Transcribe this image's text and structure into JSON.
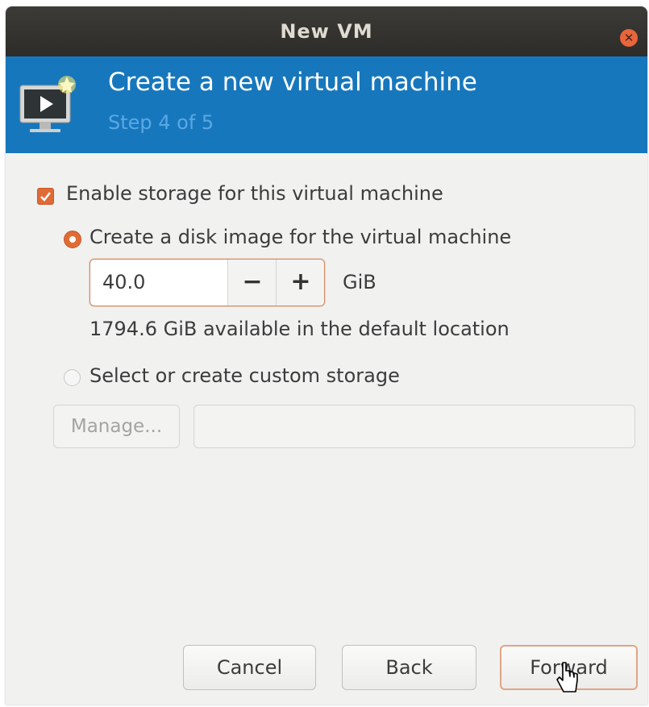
{
  "window": {
    "title": "New VM",
    "close_icon": "close-icon"
  },
  "header": {
    "title": "Create a new virtual machine",
    "step": "Step 4 of 5",
    "icon": "vm-monitor-icon",
    "accent_color": "#1777bd"
  },
  "storage": {
    "enable_label": "Enable storage for this virtual machine",
    "enable_checked": true,
    "create_disk_label": "Create a disk image for the virtual machine",
    "create_disk_selected": true,
    "size_value": "40.0",
    "size_unit": "GiB",
    "decrement_label": "−",
    "increment_label": "+",
    "available_text": "1794.6 GiB available in the default location",
    "custom_storage_label": "Select or create custom storage",
    "custom_storage_selected": false,
    "manage_label": "Manage...",
    "custom_path_value": ""
  },
  "footer": {
    "cancel_label": "Cancel",
    "back_label": "Back",
    "forward_label": "Forward"
  },
  "colors": {
    "selection_orange": "#e06b35",
    "titlebar": "#3c3b37"
  }
}
